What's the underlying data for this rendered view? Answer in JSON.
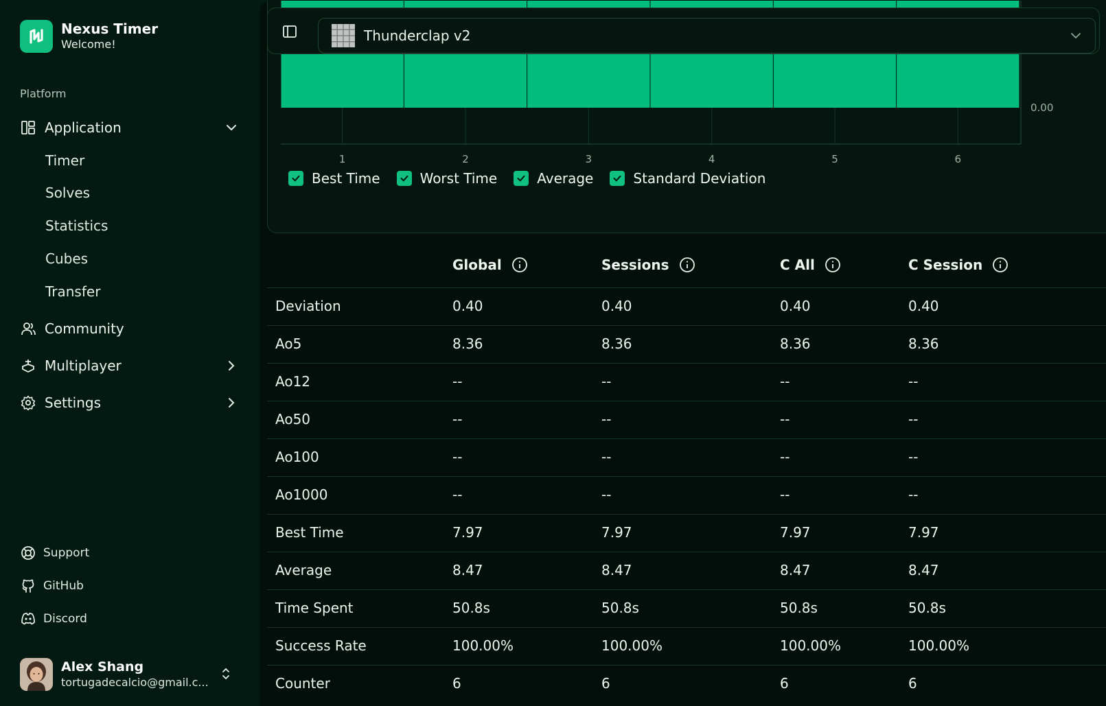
{
  "brand": {
    "name": "Nexus Timer",
    "subtitle": "Welcome!"
  },
  "sidebar": {
    "section_label": "Platform",
    "application": {
      "label": "Application",
      "icon": "layout-panel-icon",
      "expanded": true,
      "items": [
        "Timer",
        "Solves",
        "Statistics",
        "Cubes",
        "Transfer"
      ]
    },
    "community": {
      "label": "Community",
      "icon": "users-icon"
    },
    "multiplayer": {
      "label": "Multiplayer",
      "icon": "gamepad-icon"
    },
    "settings": {
      "label": "Settings",
      "icon": "gear-icon"
    },
    "footer": {
      "support": "Support",
      "github": "GitHub",
      "discord": "Discord"
    },
    "user": {
      "name": "Alex Shang",
      "email": "tortugadecalcio@gmail.c..."
    }
  },
  "toolbar": {
    "cube_name": "Thunderclap v2",
    "cube_icon": "cube-grid-icon"
  },
  "chart_data": {
    "type": "bar",
    "categories": [
      "1",
      "2",
      "3",
      "4",
      "5",
      "6"
    ],
    "y_tick_labels": [
      "0.00"
    ],
    "bar_color": "#00bd7e",
    "grid": true,
    "legend": [
      {
        "label": "Best Time",
        "checked": true
      },
      {
        "label": "Worst Time",
        "checked": true
      },
      {
        "label": "Average",
        "checked": true
      },
      {
        "label": "Standard Deviation",
        "checked": true
      }
    ]
  },
  "stats": {
    "columns": [
      "Global",
      "Sessions",
      "C All",
      "C Session"
    ],
    "rows": [
      {
        "label": "Deviation",
        "values": [
          "0.40",
          "0.40",
          "0.40",
          "0.40"
        ]
      },
      {
        "label": "Ao5",
        "values": [
          "8.36",
          "8.36",
          "8.36",
          "8.36"
        ]
      },
      {
        "label": "Ao12",
        "values": [
          "--",
          "--",
          "--",
          "--"
        ]
      },
      {
        "label": "Ao50",
        "values": [
          "--",
          "--",
          "--",
          "--"
        ]
      },
      {
        "label": "Ao100",
        "values": [
          "--",
          "--",
          "--",
          "--"
        ]
      },
      {
        "label": "Ao1000",
        "values": [
          "--",
          "--",
          "--",
          "--"
        ]
      },
      {
        "label": "Best Time",
        "values": [
          "7.97",
          "7.97",
          "7.97",
          "7.97"
        ]
      },
      {
        "label": "Average",
        "values": [
          "8.47",
          "8.47",
          "8.47",
          "8.47"
        ]
      },
      {
        "label": "Time Spent",
        "values": [
          "50.8s",
          "50.8s",
          "50.8s",
          "50.8s"
        ]
      },
      {
        "label": "Success Rate",
        "values": [
          "100.00%",
          "100.00%",
          "100.00%",
          "100.00%"
        ]
      },
      {
        "label": "Counter",
        "values": [
          "6",
          "6",
          "6",
          "6"
        ]
      }
    ]
  },
  "colors": {
    "accent": "#10c082",
    "background": "#021a12",
    "main_background": "#020f0a"
  }
}
